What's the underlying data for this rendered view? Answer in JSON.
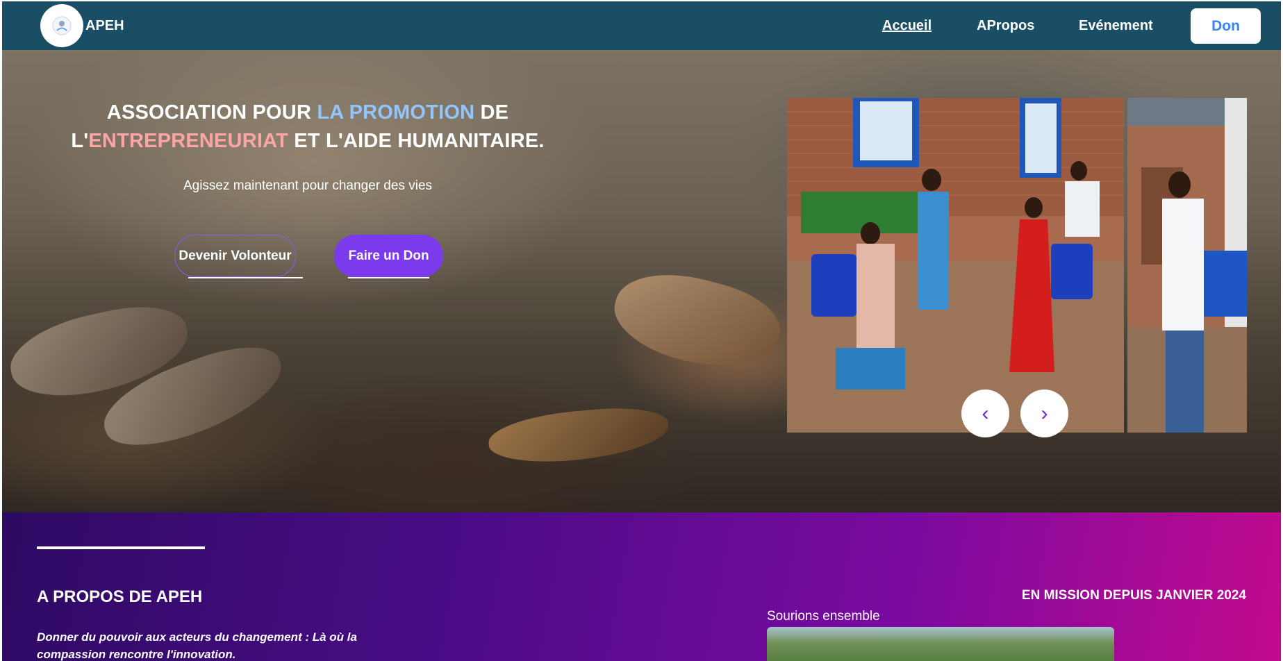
{
  "nav": {
    "brand": "APEH",
    "links": [
      "Accueil",
      "APropos",
      "Evénement"
    ],
    "don_label": "Don",
    "logo_icon": "apeh-logo-icon"
  },
  "hero": {
    "title_part1": "ASSOCIATION POUR ",
    "title_highlight1": "LA PROMOTION",
    "title_part2": " DE",
    "title_part3": "L'",
    "title_highlight2": "ENTREPRENEURIAT",
    "title_part4": " ET L'AIDE HUMANITAIRE.",
    "subtitle": "Agissez maintenant pour changer des vies",
    "volunteer_label": "Devenir Volonteur",
    "donate_label": "Faire un Don",
    "colors": {
      "highlight_blue": "#93c5fd",
      "highlight_pink": "#fca5a5",
      "button_purple": "#7c3aed"
    }
  },
  "carousel": {
    "prev_label": "‹",
    "next_label": "›",
    "slides": [
      "event-photo-1",
      "event-photo-2"
    ]
  },
  "about": {
    "title": "A PROPOS DE APEH",
    "quote": "Donner du pouvoir aux acteurs du changement : Là où la compassion rencontre l'innovation.",
    "mission": "EN MISSION DEPUIS JANVIER 2024",
    "support_label": "Sourions ensemble"
  },
  "colors": {
    "nav_bg": "#194e64",
    "about_gradient_start": "#2e0a63",
    "about_gradient_end": "#c20a8e"
  }
}
